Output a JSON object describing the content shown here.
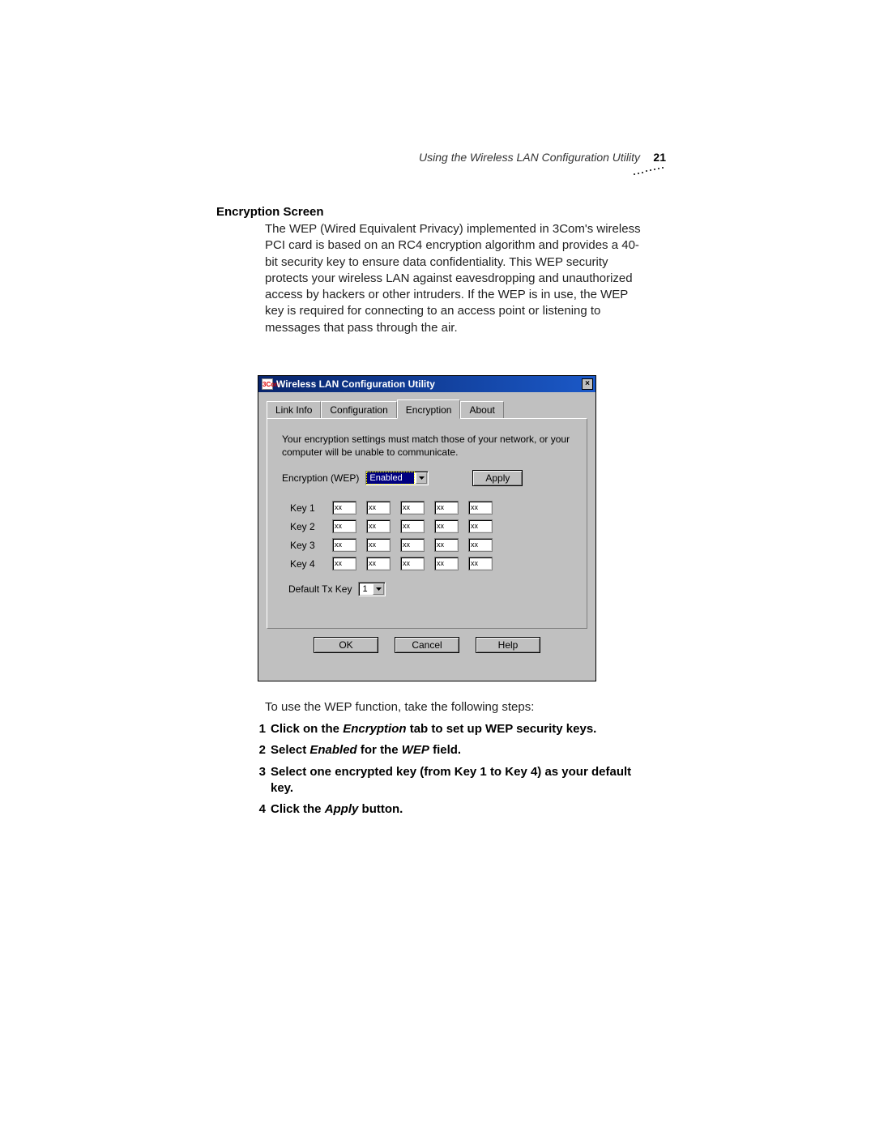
{
  "header": {
    "running_title": "Using the Wireless LAN Configuration Utility",
    "page_number": "21"
  },
  "section": {
    "title": "Encryption Screen",
    "body": "The WEP (Wired Equivalent Privacy) implemented in 3Com's wireless PCI card is based on an RC4 encryption algorithm and provides a 40-bit security key to ensure data confidentiality. This WEP security protects your wireless LAN against eavesdropping and unauthorized access by hackers or other intruders. If the WEP is in use, the WEP key is required for connecting to an access point or listening to messages that pass through the air."
  },
  "dialog": {
    "title": "Wireless LAN Configuration Utility",
    "close_icon": "×",
    "app_icon_text": "3Com",
    "tabs": [
      "Link Info",
      "Configuration",
      "Encryption",
      "About"
    ],
    "active_tab_index": 2,
    "panel": {
      "instruction": "Your encryption settings must match those of your network, or your computer will be unable to communicate.",
      "encryption_label": "Encryption (WEP)",
      "encryption_value": "Enabled",
      "apply_label": "Apply",
      "key_labels": [
        "Key 1",
        "Key 2",
        "Key 3",
        "Key 4"
      ],
      "key_placeholder": "xx",
      "default_tx_label": "Default Tx Key",
      "default_tx_value": "1"
    },
    "buttons": {
      "ok": "OK",
      "cancel": "Cancel",
      "help": "Help"
    }
  },
  "post_text": "To use the WEP function, take the following steps:",
  "steps": [
    {
      "num": "1",
      "pre": "Click on the ",
      "em": "Encryption",
      "post": " tab to set up WEP security keys."
    },
    {
      "num": "2",
      "pre": "Select ",
      "em": "Enabled",
      "post": " for the ",
      "em2": "WEP",
      "post2": " field."
    },
    {
      "num": "3",
      "pre": "Select one encrypted key (from Key 1 to Key 4) as your default key."
    },
    {
      "num": "4",
      "pre": "Click the ",
      "em": "Apply",
      "post": " button."
    }
  ]
}
